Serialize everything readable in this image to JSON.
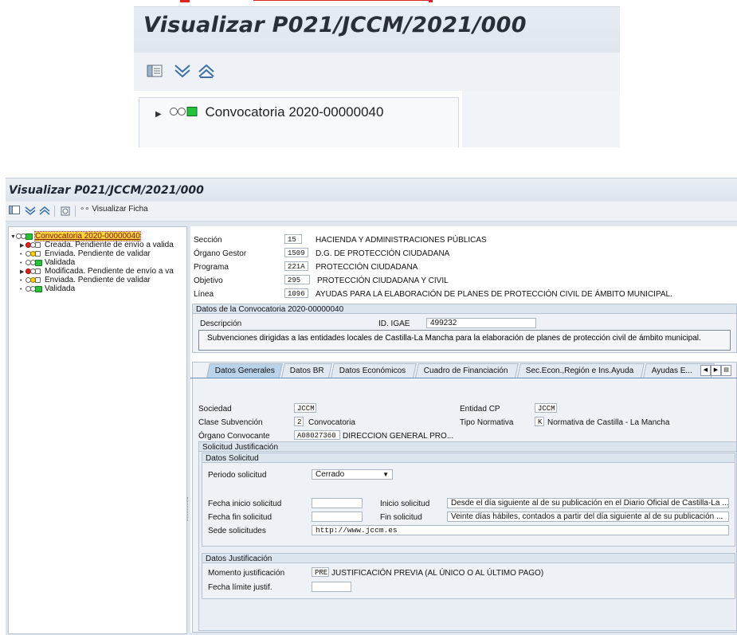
{
  "zoom": {
    "title": "Visualizar P021/JCCM/2021/000",
    "tree_item": "Convocatoria 2020-00000040"
  },
  "main": {
    "title": "Visualizar P021/JCCM/2021/000",
    "toolbar": {
      "visualizar_ficha": "Visualizar Ficha"
    },
    "tree": [
      {
        "label": "Convocatoria 2020-00000040",
        "status": "green",
        "arrow": "▼"
      },
      {
        "label": "Creada. Pendiente de envío a valida",
        "status": "red",
        "arrow": "▶"
      },
      {
        "label": "Enviada. Pendiente de validar",
        "status": "yellow",
        "arrow": "•"
      },
      {
        "label": "Validada",
        "status": "green",
        "arrow": "•"
      },
      {
        "label": "Modificada. Pendiente de envío a va",
        "status": "red",
        "arrow": "▶"
      },
      {
        "label": "Enviada. Pendiente de validar",
        "status": "yellow",
        "arrow": "•"
      },
      {
        "label": "Validada",
        "status": "green",
        "arrow": "•"
      }
    ],
    "header_fields": {
      "seccion": {
        "label": "Sección",
        "code": "15",
        "text": "HACIENDA Y ADMINISTRACIONES PÚBLICAS"
      },
      "organo": {
        "label": "Órgano Gestor",
        "code": "1509",
        "text": "D.G. DE PROTECCIÓN CIUDADANA"
      },
      "programa": {
        "label": "Programa",
        "code": "221A",
        "text": "PROTECCIÓN CIUDADANA"
      },
      "objetivo": {
        "label": "Objetivo",
        "code": "295",
        "text": "PROTECCIÓN CIUDADANA Y CIVIL"
      },
      "linea": {
        "label": "Línea",
        "code": "1096",
        "text": "AYUDAS PARA LA ELABORACIÓN DE PLANES DE PROTECCIÓN CIVIL DE ÁMBITO MUNICIPAL."
      }
    },
    "datos_convocatoria": {
      "title": "Datos de la Convocatoria 2020-00000040",
      "descripcion_label": "Descripción",
      "igae_label": "ID. IGAE",
      "igae_value": "499232",
      "descripcion_text": "Subvenciones dirigidas a las entidades locales de Castilla-La Mancha para la elaboración de planes de protección civil de ámbito municipal."
    },
    "tabs": [
      "Datos Generales",
      "Datos BR",
      "Datos Económicos",
      "Cuadro de Financiación",
      "Sec.Econ.,Región e Ins.Ayuda",
      "Ayudas E..."
    ],
    "generales": {
      "sociedad_label": "Sociedad",
      "sociedad_value": "JCCM",
      "entidad_label": "Entidad CP",
      "entidad_value": "JCCM",
      "clase_label": "Clase Subvención",
      "clase_code": "2",
      "clase_text": "Convocatoria",
      "tipo_label": "Tipo Normativa",
      "tipo_code": "K",
      "tipo_text": "Normativa de Castilla - La Mancha",
      "organo_conv_label": "Órgano Convocante",
      "organo_conv_code": "A08027360",
      "organo_conv_text": "DIRECCION GENERAL PRO..."
    },
    "solicitud": {
      "title": "Solicitud Justificación",
      "datos_solicitud_title": "Datos Solicitud",
      "periodo_label": "Periodo solicitud",
      "periodo_value": "Cerrado",
      "fecha_inicio_label": "Fecha inicio solicitud",
      "fecha_inicio_value": "",
      "inicio_label": "Inicio solicitud",
      "inicio_value": "Desde el día siguiente al de su publicación en el Diario Oficial de Castilla-La ...",
      "fecha_fin_label": "Fecha fin solicitud",
      "fecha_fin_value": "",
      "fin_label": "Fin solicitud",
      "fin_value": "Veinte días hábiles, contados a partir del día siguiente al de su publicación ...",
      "sede_label": "Sede solicitudes",
      "sede_value": "http://www.jccm.es",
      "datos_just_title": "Datos Justificación",
      "momento_label": "Momento justificación",
      "momento_code": "PRE",
      "momento_text": "JUSTIFICACIÓN PREVIA (AL ÚNICO O AL ÚLTIMO PAGO)",
      "fecha_limite_label": "Fecha límite justif.",
      "fecha_limite_value": ""
    }
  }
}
